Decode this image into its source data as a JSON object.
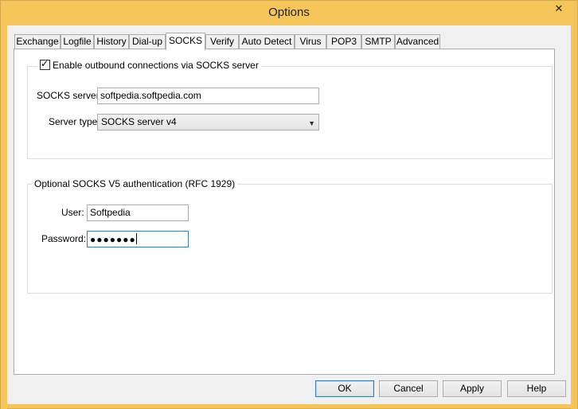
{
  "window": {
    "title": "Options",
    "close_glyph": "✕"
  },
  "tabs": [
    {
      "label": "Exchange"
    },
    {
      "label": "Logfile"
    },
    {
      "label": "History"
    },
    {
      "label": "Dial-up"
    },
    {
      "label": "SOCKS"
    },
    {
      "label": "Verify"
    },
    {
      "label": "Auto Detect"
    },
    {
      "label": "Virus"
    },
    {
      "label": "POP3"
    },
    {
      "label": "SMTP"
    },
    {
      "label": "Advanced"
    }
  ],
  "active_tab": "SOCKS",
  "socks_group": {
    "enable_label": "Enable outbound connections via SOCKS server",
    "enable_checked": true,
    "server_label": "SOCKS server:",
    "server_value": "softpedia.softpedia.com",
    "type_label": "Server type:",
    "type_value": "SOCKS server v4"
  },
  "auth_group": {
    "legend": "Optional SOCKS V5 authentication (RFC 1929)",
    "user_label": "User:",
    "user_value": "Softpedia",
    "password_label": "Password:",
    "password_mask": "●●●●●●●"
  },
  "buttons": {
    "ok": "OK",
    "cancel": "Cancel",
    "apply": "Apply",
    "help": "Help"
  }
}
